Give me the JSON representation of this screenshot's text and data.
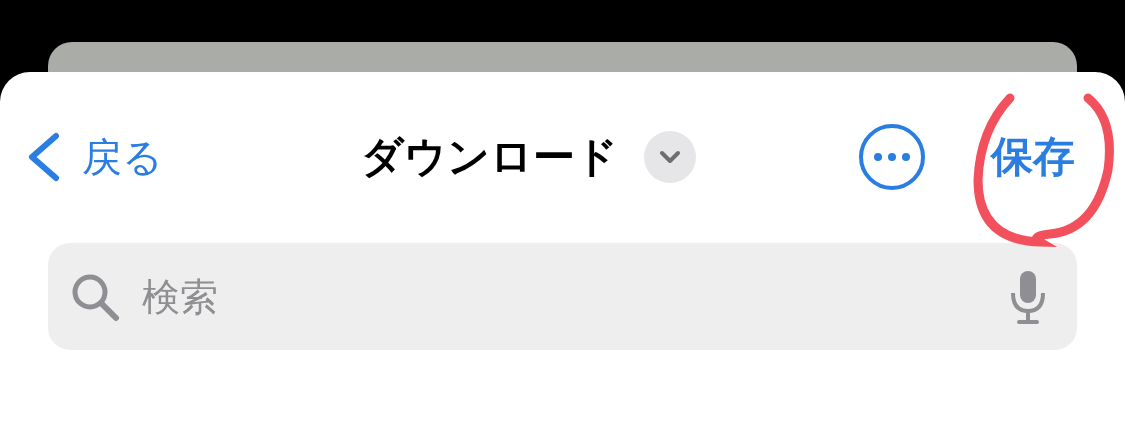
{
  "nav": {
    "back_label": "戻る",
    "title": "ダウンロード",
    "save_label": "保存"
  },
  "search": {
    "placeholder": "検索"
  }
}
